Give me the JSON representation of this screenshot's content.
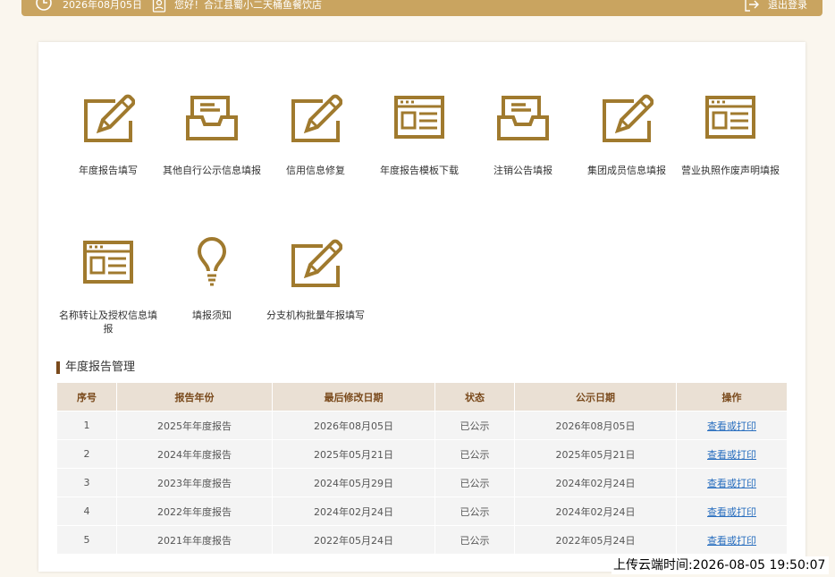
{
  "header": {
    "date": "2026年08月05日",
    "greeting": "您好！合江县蜀小二天桶鱼餐饮店",
    "logout": "退出登录"
  },
  "tiles": [
    {
      "label": "年度报告填写",
      "icon": "edit-pencil-icon"
    },
    {
      "label": "其他自行公示信息填报",
      "icon": "inbox-tray-icon"
    },
    {
      "label": "信用信息修复",
      "icon": "edit-pencil-icon"
    },
    {
      "label": "年度报告模板下载",
      "icon": "browser-window-icon"
    },
    {
      "label": "注销公告填报",
      "icon": "inbox-tray-icon"
    },
    {
      "label": "集团成员信息填报",
      "icon": "edit-pencil-icon"
    },
    {
      "label": "营业执照作废声明填报",
      "icon": "browser-window-icon"
    },
    {
      "label": "名称转让及授权信息填报",
      "icon": "browser-window-icon"
    },
    {
      "label": "填报须知",
      "icon": "lightbulb-icon"
    },
    {
      "label": "分支机构批量年报填写",
      "icon": "edit-pencil-icon"
    }
  ],
  "report_section": {
    "title": "年度报告管理",
    "columns": [
      "序号",
      "报告年份",
      "最后修改日期",
      "状态",
      "公示日期",
      "操作"
    ],
    "rows": [
      {
        "no": "1",
        "year": "2025年年度报告",
        "modified": "2026年08月05日",
        "status": "已公示",
        "published": "2026年08月05日",
        "action": "查看或打印"
      },
      {
        "no": "2",
        "year": "2024年年度报告",
        "modified": "2025年05月21日",
        "status": "已公示",
        "published": "2025年05月21日",
        "action": "查看或打印"
      },
      {
        "no": "3",
        "year": "2023年年度报告",
        "modified": "2024年05月29日",
        "status": "已公示",
        "published": "2024年02月24日",
        "action": "查看或打印"
      },
      {
        "no": "4",
        "year": "2022年年度报告",
        "modified": "2024年02月24日",
        "status": "已公示",
        "published": "2024年02月24日",
        "action": "查看或打印"
      },
      {
        "no": "5",
        "year": "2021年年度报告",
        "modified": "2022年05月24日",
        "status": "已公示",
        "published": "2022年05月24日",
        "action": "查看或打印"
      }
    ]
  },
  "timestamp": "上传云端时间:2026-08-05 19:50:07",
  "colors": {
    "accent": "#c9a460",
    "icon": "#a07a2e",
    "header_text": "#7a4a1c",
    "link": "#2a6fbf"
  }
}
